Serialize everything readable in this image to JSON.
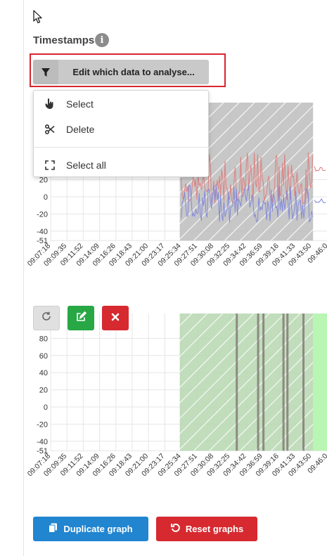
{
  "section": {
    "title": "Timestamps"
  },
  "edit_button": {
    "label": "Edit which data to analyse...",
    "icon": "filter-icon"
  },
  "menu": {
    "items": [
      {
        "label": "Select",
        "icon": "pointer-hand-icon"
      },
      {
        "label": "Delete",
        "icon": "scissors-icon"
      },
      {
        "label": "Select all",
        "icon": "expand-corners-icon"
      }
    ]
  },
  "toolbar": {
    "refresh_icon": "refresh-icon",
    "edit_icon": "edit-icon",
    "close_icon": "close-icon"
  },
  "buttons": {
    "duplicate": "Duplicate graph",
    "reset": "Reset graphs"
  },
  "colors": {
    "blue_btn": "#2185d0",
    "red_btn": "#d62a30",
    "green_btn": "#27a844",
    "chart1_selection": "#bdbdbd",
    "chart2_selection": "#b6d7b0",
    "chart2_bright": "#b9f5b3",
    "series_red": "#e07878",
    "series_blue": "#7b83d9"
  },
  "chart_data": [
    {
      "type": "line",
      "x_ticks": [
        "09:07:18",
        "09:09:35",
        "09:11:52",
        "09:14:09",
        "09:16:26",
        "09:18:43",
        "09:21:00",
        "09:23:17",
        "09:25:34",
        "09:27:51",
        "09:30:08",
        "09:32:25",
        "09:34:42",
        "09:36:59",
        "09:39:16",
        "09:41:33",
        "09:43:50",
        "09:46:0"
      ],
      "y_ticks": [
        "20",
        "0",
        "-20",
        "-40",
        "-51"
      ],
      "y_ticks_values": [
        20,
        0,
        -20,
        -40,
        -51
      ],
      "selection": [
        "09:25:34",
        "09:43:50"
      ],
      "series": [
        {
          "color": "#e07878"
        },
        {
          "color": "#7b83d9"
        }
      ]
    },
    {
      "type": "area",
      "x_ticks": [
        "09:07:18",
        "09:09:35",
        "09:11:52",
        "09:14:09",
        "09:16:26",
        "09:18:43",
        "09:21:00",
        "09:23:17",
        "09:25:34",
        "09:27:51",
        "09:30:08",
        "09:32:25",
        "09:34:42",
        "09:36:59",
        "09:39:16",
        "09:41:33",
        "09:43:50",
        "09:46:0"
      ],
      "y_ticks": [
        "80",
        "60",
        "40",
        "20",
        "0",
        "-20",
        "-40",
        "-51"
      ],
      "y_ticks_values": [
        80,
        60,
        40,
        20,
        0,
        -20,
        -40,
        -51
      ],
      "selection": [
        "09:25:34",
        "09:43:50"
      ]
    }
  ]
}
